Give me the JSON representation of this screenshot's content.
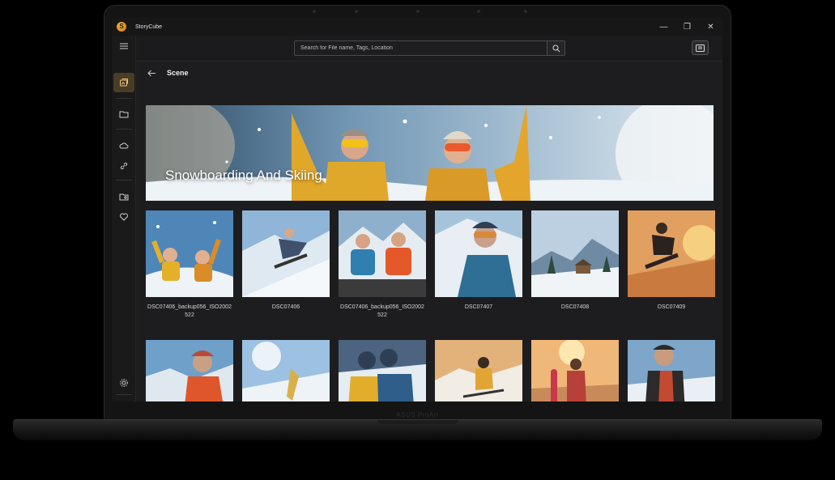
{
  "app": {
    "title": "StoryCube",
    "logo_letter": "S"
  },
  "device": {
    "brand_label": "ASUS ProArt"
  },
  "window_controls": {
    "minimize": "—",
    "restore": "❐",
    "close": "✕"
  },
  "search": {
    "placeholder": "Search for File name, Tags, Location",
    "value": ""
  },
  "header": {
    "title": "Scene"
  },
  "banner": {
    "title": "Snowboarding And Skiing"
  },
  "sidebar": {
    "items": [
      {
        "icon": "hamburger-menu-icon"
      },
      {
        "icon": "scene-icon",
        "active": true
      },
      {
        "icon": "folder-icon"
      },
      {
        "icon": "cloud-icon"
      },
      {
        "icon": "link-icon"
      },
      {
        "icon": "folder-photo-icon"
      },
      {
        "icon": "heart-icon"
      },
      {
        "icon": "settings-icon"
      },
      {
        "icon": "add-icon"
      }
    ]
  },
  "gallery": {
    "row1": [
      {
        "name": "DSC07406_backup056_ISO2002522"
      },
      {
        "name": "DSC07406"
      },
      {
        "name": "DSC07406_backup056_ISO2002522"
      },
      {
        "name": "DSC07407"
      },
      {
        "name": "DSC07408"
      },
      {
        "name": "DSC07409"
      }
    ],
    "row2_count_visible": 6
  },
  "colors": {
    "accent": "#4a3d26",
    "background": "#1d1d1f",
    "snow_sky": "#9ec3e0"
  }
}
